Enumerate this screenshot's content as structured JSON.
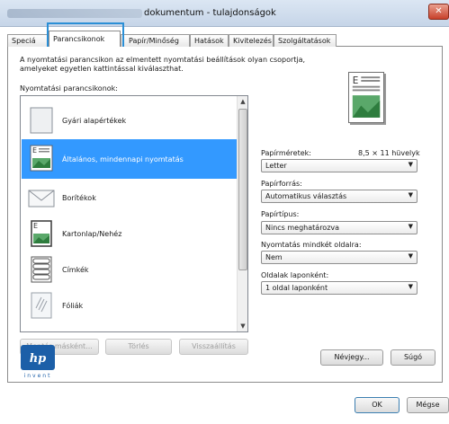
{
  "window": {
    "title": "dokumentum - tulajdonságok",
    "close_label": "✕"
  },
  "tabs": [
    {
      "label": "Speciá"
    },
    {
      "label": "Parancsikonok"
    },
    {
      "label": "Papír/Minőség"
    },
    {
      "label": "Hatások"
    },
    {
      "label": "Kivitelezés"
    },
    {
      "label": "Szolgáltatások"
    }
  ],
  "intro": {
    "line1": "A nyomtatási parancsikon az elmentett nyomtatási beállítások olyan csoportja,",
    "line2": "amelyeket egyetlen kattintással kiválaszthat."
  },
  "shortcuts_label": "Nyomtatási parancsikonok:",
  "shortcuts": [
    {
      "label": "Gyári alapértékek",
      "icon": "blank-page-icon",
      "selected": false
    },
    {
      "label": "Általános, mindennapi nyomtatás",
      "icon": "document-page-icon",
      "selected": true
    },
    {
      "label": "Borítékok",
      "icon": "envelope-icon",
      "selected": false
    },
    {
      "label": "Kartonlap/Nehéz",
      "icon": "cardstock-icon",
      "selected": false
    },
    {
      "label": "Címkék",
      "icon": "labels-icon",
      "selected": false
    },
    {
      "label": "Fóliák",
      "icon": "transparency-icon",
      "selected": false
    }
  ],
  "list_buttons": {
    "save_as": "Mentés másként...",
    "delete": "Törlés",
    "restore": "Visszaállítás"
  },
  "settings": {
    "paper_size_label": "Papírméretek:",
    "paper_size_dims": "8,5 × 11 hüvelyk",
    "paper_size_value": "Letter",
    "paper_source_label": "Papírforrás:",
    "paper_source_value": "Automatikus választás",
    "paper_type_label": "Papírtípus:",
    "paper_type_value": "Nincs meghatározva",
    "duplex_label": "Nyomtatás mindkét oldalra:",
    "duplex_value": "Nem",
    "pages_per_sheet_label": "Oldalak laponként:",
    "pages_per_sheet_value": "1 oldal laponként"
  },
  "logo": {
    "text": "hp",
    "tagline": "invent"
  },
  "footer": {
    "about": "Névjegy...",
    "help": "Súgó",
    "ok": "OK",
    "cancel": "Mégse"
  }
}
